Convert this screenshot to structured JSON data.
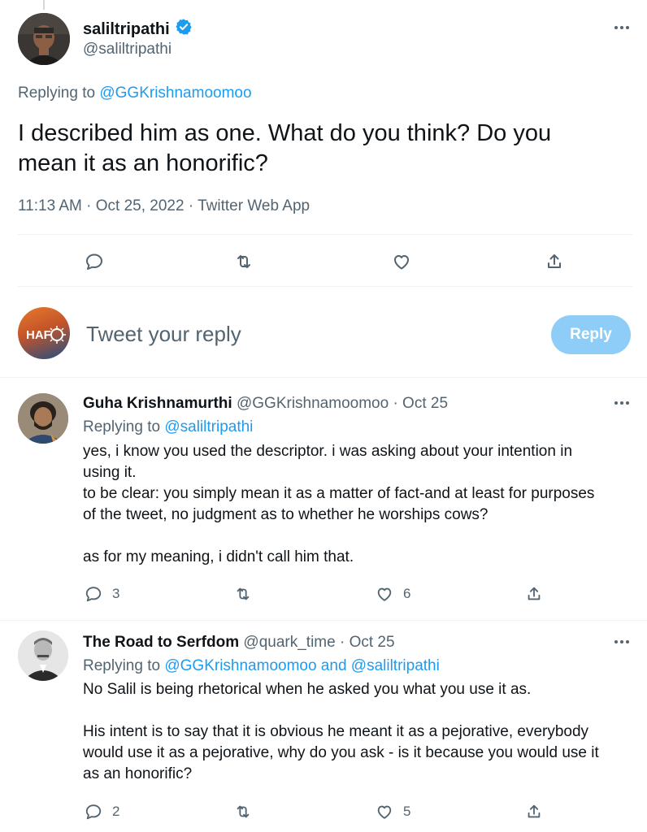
{
  "main_tweet": {
    "author_name": "saliltripathi",
    "author_handle": "@saliltripathi",
    "verified": true,
    "replying_prefix": "Replying to",
    "replying_to": "@GGKrishnamoomoo",
    "text_line1": "I described him as one. What do you think? Do you",
    "text_line2": "mean it as an honorific?",
    "meta": "11:13 AM · Oct 25, 2022 · Twitter Web App",
    "icons": [
      "reply-icon",
      "retweet-icon",
      "like-icon",
      "share-icon"
    ]
  },
  "composer": {
    "avatar_text": "HAF",
    "placeholder": "Tweet your reply",
    "button_label": "Reply"
  },
  "replies": [
    {
      "author_name": "Guha Krishnamurthi",
      "author_handle": "@GGKrishnamoomoo",
      "date": "· Oct 25",
      "replying_prefix": "Replying to",
      "replying_to": "@saliltripathi",
      "body": [
        "yes, i know you used the descriptor. i was asking about your intention in",
        "using it.",
        "to be clear: you simply mean it as a matter of fact-and at least for purposes",
        "of the tweet, no judgment as to whether he worships cows?",
        "",
        "as for my meaning, i didn't call him that."
      ],
      "reply_count": "3",
      "like_count": "6"
    },
    {
      "author_name": "The Road to Serfdom",
      "author_handle": "@quark_time",
      "date": "· Oct 25",
      "replying_prefix": "Replying to",
      "replying_to": "@GGKrishnamoomoo and @saliltripathi",
      "body": [
        "No Salil is being rhetorical when he asked you what you use it as.",
        "",
        "His intent is to say that it is obvious he meant it as a pejorative, everybody",
        "would use it as a pejorative, why do you ask - is it because you would use it",
        "as an honorific?"
      ],
      "reply_count": "2",
      "like_count": "5"
    }
  ],
  "colors": {
    "link": "#1d9bf0",
    "muted": "#536471",
    "reply_button": "#8ecdf8",
    "verified": "#1d9bf0"
  }
}
